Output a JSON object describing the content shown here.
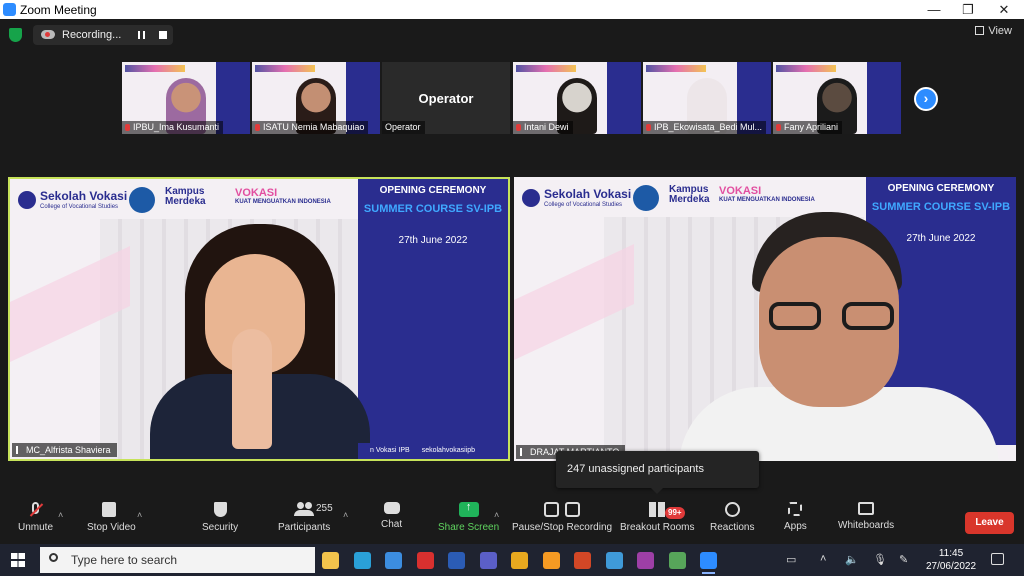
{
  "window": {
    "title": "Zoom Meeting",
    "min": "—",
    "max": "❐",
    "close": "✕"
  },
  "recording": {
    "label": "Recording..."
  },
  "view": {
    "label": "View"
  },
  "thumbnails": [
    {
      "name": "IPBU_Ima Kusumanti",
      "type": "video",
      "skin": "#c99378",
      "hijab": "#9c6aa0"
    },
    {
      "name": "ISATU Nemia Mabaquiao",
      "type": "video",
      "skin": "#c38f73",
      "hijab": "#2a1c18"
    },
    {
      "name": "Operator",
      "type": "blank",
      "display": "Operator"
    },
    {
      "name": "Intani Dewi",
      "type": "video",
      "skin": "#d7d3cd",
      "hijab": "#1e1a18"
    },
    {
      "name": "IPB_Ekowisata_Bedi Mul...",
      "type": "video",
      "skin": "#ede6e9",
      "hijab": "#ede6e9"
    },
    {
      "name": "Fany Apriliani",
      "type": "video",
      "skin": "#5b4b40",
      "hijab": "#1b1b1b"
    }
  ],
  "main_videos": [
    {
      "name": "MC_Alfrista Shaviera",
      "ceremony": "OPENING CEREMONY",
      "course": "SUMMER COURSE SV-IPB",
      "date": "27th June 2022",
      "sekolah": "Sekolah Vokasi",
      "college": "College of Vocational Studies",
      "kampus": "Kampus Merdeka",
      "vokasi": "VOKASI",
      "vokasi_sub": "KUAT MENGUATKAN INDONESIA",
      "handle_left": "n Vokasi IPB",
      "handle_right": "sekolahvokasiipb"
    },
    {
      "name": "DRAJAT MARTIANTO",
      "ceremony": "OPENING CEREMONY",
      "course": "SUMMER COURSE SV-IPB",
      "date": "27th June 2022",
      "sekolah": "Sekolah Vokasi",
      "college": "College of Vocational Studies",
      "kampus": "Kampus Merdeka",
      "vokasi": "VOKASI",
      "vokasi_sub": "KUAT MENGUATKAN INDONESIA"
    }
  ],
  "tooltip": {
    "text": "247 unassigned participants"
  },
  "toolbar": {
    "unmute": "Unmute",
    "stop_video": "Stop Video",
    "security": "Security",
    "participants": "Participants",
    "participants_count": "255",
    "chat": "Chat",
    "share_screen": "Share Screen",
    "pause_stop_recording": "Pause/Stop Recording",
    "breakout_rooms": "Breakout Rooms",
    "breakout_badge": "99+",
    "reactions": "Reactions",
    "apps": "Apps",
    "whiteboards": "Whiteboards",
    "leave": "Leave",
    "caret": "˄"
  },
  "taskbar": {
    "search_placeholder": "Type here to search",
    "time": "11:45",
    "date": "27/06/2022",
    "apps": [
      {
        "name": "file-explorer-icon",
        "color": "#f2c34c"
      },
      {
        "name": "edge-icon",
        "color": "#2aa0d8"
      },
      {
        "name": "mail-icon",
        "color": "#3c8de0"
      },
      {
        "name": "acrobat-icon",
        "color": "#d8302f"
      },
      {
        "name": "word-icon",
        "color": "#2b5cb5"
      },
      {
        "name": "teams-icon",
        "color": "#5b5fc7"
      },
      {
        "name": "chrome-icon",
        "color": "#e8a91f"
      },
      {
        "name": "app-orange-icon",
        "color": "#f59a23"
      },
      {
        "name": "powerpoint-icon",
        "color": "#d24726"
      },
      {
        "name": "photos-icon",
        "color": "#3f9ad9"
      },
      {
        "name": "winrar-icon",
        "color": "#9d3fa6"
      },
      {
        "name": "app-image-icon",
        "color": "#57a55a"
      },
      {
        "name": "zoom-icon",
        "color": "#2d8cff"
      }
    ]
  }
}
